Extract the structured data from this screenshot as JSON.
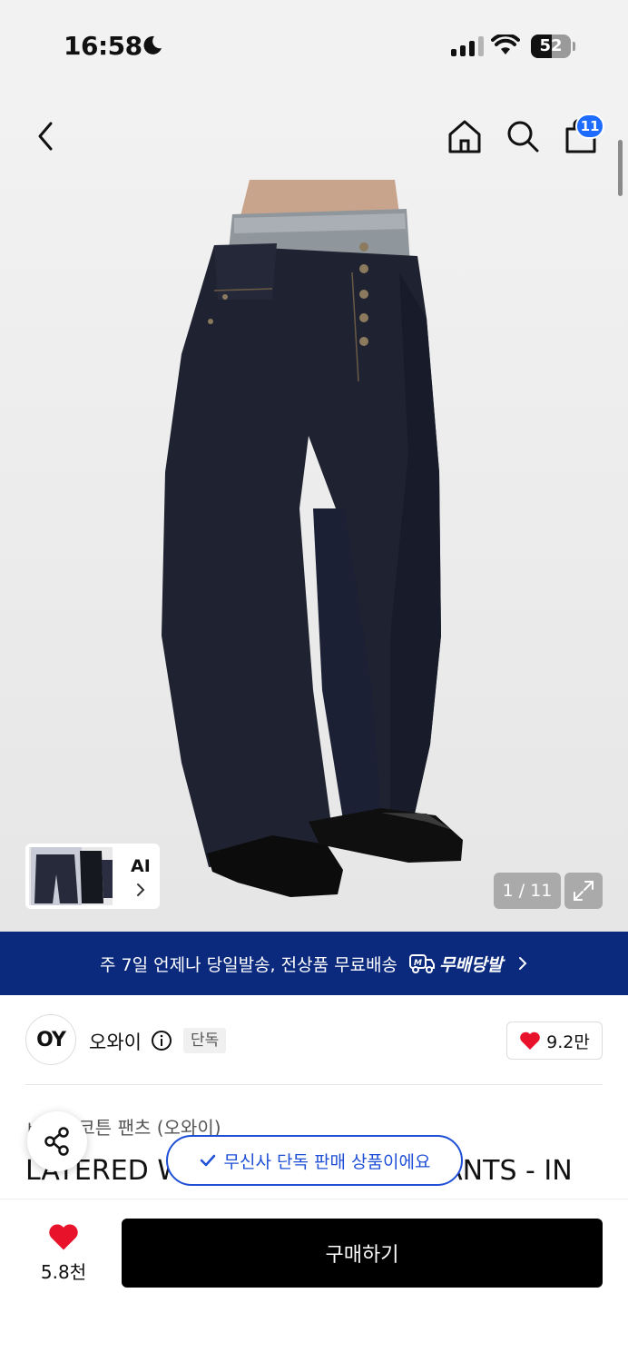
{
  "status_bar": {
    "time": "16:58",
    "battery": "52",
    "battery_level": 0.52
  },
  "header": {
    "cart_count": "11"
  },
  "gallery": {
    "ai_label": "AI",
    "page_counter": "1 / 11"
  },
  "shipping_banner": {
    "text": "주 7일 언제나 당일발송, 전상품 무료배송",
    "logo_text": "무배당발"
  },
  "brand": {
    "logo_text": "OY",
    "name": "오와이",
    "exclusive_tag": "단독",
    "likes": "9.2만"
  },
  "product": {
    "category": "코튼 팬츠 (오와이)",
    "title": "LAYERED W",
    "title_tail": "PANTS - IN"
  },
  "toast": {
    "text": "무신사 단독 판매 상품이에요"
  },
  "bottom_bar": {
    "like_count": "5.8천",
    "buy_label": "구매하기"
  },
  "colors": {
    "banner": "#0b2a7e",
    "accent_blue": "#1e6bff",
    "heart": "#e8132a"
  }
}
